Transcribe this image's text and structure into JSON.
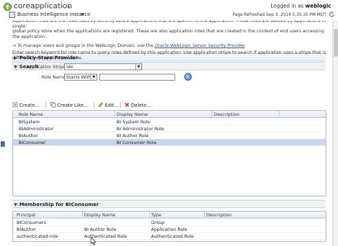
{
  "header": {
    "app_title": "coreapplication",
    "instance_label": "Business Intelligence Instance",
    "logged_in_prefix": "Logged in as",
    "username": "weblogic",
    "refreshed": "Page Refreshed Sep 3, 2014 5:35:35 PM MDT"
  },
  "intro": {
    "text_cut": "Application roles are the roles used by security aware applications that are specific to the application. These roles are seeded by applications in single",
    "text": "global policy store when the applications are registered. These are also application roles that are created in the context of end users accessing the application.",
    "manage_prefix": "To manage users and groups in the WebLogic Domain, use the",
    "manage_link": "Oracle WebLogic Server Security Provider",
    "manage_suffix": "."
  },
  "sections": {
    "policy_store": "Policy Store Provider",
    "search": "Search",
    "membership": "Membership for BIConsumer"
  },
  "search": {
    "description": "Enter search keyword for role name to query roles defined by this application. Use application stripe to search if application uses a stripe that is different from application name.",
    "stripe_label": "Application Stripe",
    "stripe_value": "obi",
    "role_name_label": "Role Name",
    "operator_value": "Starts With",
    "role_name_value": ""
  },
  "toolbar": {
    "create": "Create...",
    "create_like": "Create Like...",
    "edit": "Edit...",
    "delete": "Delete..."
  },
  "roles_table": {
    "headers": [
      "Role Name",
      "Display Name",
      "Description"
    ],
    "rows": [
      [
        "BISystem",
        "BI System Role",
        ""
      ],
      [
        "BIAdministrator",
        "BI Administrator Role",
        ""
      ],
      [
        "BIAuthor",
        "BI Author Role",
        ""
      ],
      [
        "BIConsumer",
        "BI Consumer Role",
        ""
      ]
    ],
    "selected_row": 3
  },
  "members_table": {
    "headers": [
      "Principal",
      "Display Name",
      "Type",
      "Description"
    ],
    "rows": [
      [
        "BIConsumers",
        "",
        "Group",
        ""
      ],
      [
        "BIAuthor",
        "BI Author Role",
        "Application Role",
        ""
      ],
      [
        "authenticated-role",
        "Authenticated Role",
        "Authenticated Role",
        ""
      ]
    ]
  },
  "colors": {
    "accent": "#1a4fa0",
    "selected_row": "#c8d6ea",
    "section_bar": "#eef2f7"
  }
}
